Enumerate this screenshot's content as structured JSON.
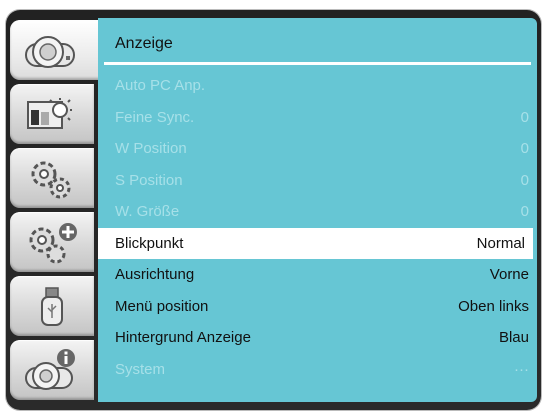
{
  "sidebar": {
    "tabs": [
      {
        "name": "camera-tab",
        "icon": "projector-icon"
      },
      {
        "name": "picture-tab",
        "icon": "picture-brightness-icon"
      },
      {
        "name": "settings-tab",
        "icon": "gears-icon"
      },
      {
        "name": "extended-tab",
        "icon": "gears-plus-icon"
      },
      {
        "name": "usb-tab",
        "icon": "usb-drive-icon"
      },
      {
        "name": "info-tab",
        "icon": "projector-info-icon"
      }
    ],
    "active_index": 0
  },
  "menu": {
    "title": "Anzeige",
    "items": [
      {
        "label": "Auto PC Anp.",
        "value": "",
        "state": "disabled"
      },
      {
        "label": "Feine Sync.",
        "value": "0",
        "state": "disabled"
      },
      {
        "label": "W Position",
        "value": "0",
        "state": "disabled"
      },
      {
        "label": "S Position",
        "value": "0",
        "state": "disabled"
      },
      {
        "label": "W. Größe",
        "value": "0",
        "state": "disabled"
      },
      {
        "label": "Blickpunkt",
        "value": "Normal",
        "state": "selected"
      },
      {
        "label": "Ausrichtung",
        "value": "Vorne",
        "state": "normal"
      },
      {
        "label": "Menü position",
        "value": "Oben links",
        "state": "normal"
      },
      {
        "label": "Hintergrund Anzeige",
        "value": "Blau",
        "state": "normal"
      },
      {
        "label": "System",
        "value": "···",
        "state": "disabled"
      }
    ]
  },
  "colors": {
    "panel_bg": "#66c6d4",
    "disabled_text": "#a6e0e8",
    "highlight": "#ffffff"
  }
}
